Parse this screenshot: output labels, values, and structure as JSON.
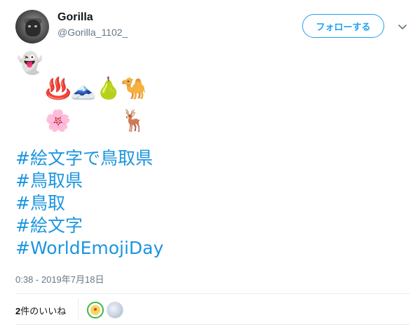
{
  "user": {
    "display_name": "Gorilla",
    "handle": "@Gorilla_1102_"
  },
  "follow_button": {
    "label": "フォローする"
  },
  "icons": {
    "menu": "chevron-down-icon"
  },
  "emojis": {
    "row1": [
      "👻"
    ],
    "row2": [
      "♨️",
      "🗻",
      "🍐",
      "🐪"
    ],
    "row3": [
      "🌸",
      "🦌"
    ]
  },
  "hashtags": [
    "#絵文字で鳥取県",
    "#鳥取県",
    "#鳥取",
    "#絵文字",
    "#WorldEmojiDay"
  ],
  "timestamp": "0:38 - 2019年7月18日",
  "likes": {
    "count": "2",
    "label": "件のいいね"
  },
  "colors": {
    "accent": "#1da1f2",
    "hashtag": "#1b95e0",
    "muted": "#657786"
  }
}
